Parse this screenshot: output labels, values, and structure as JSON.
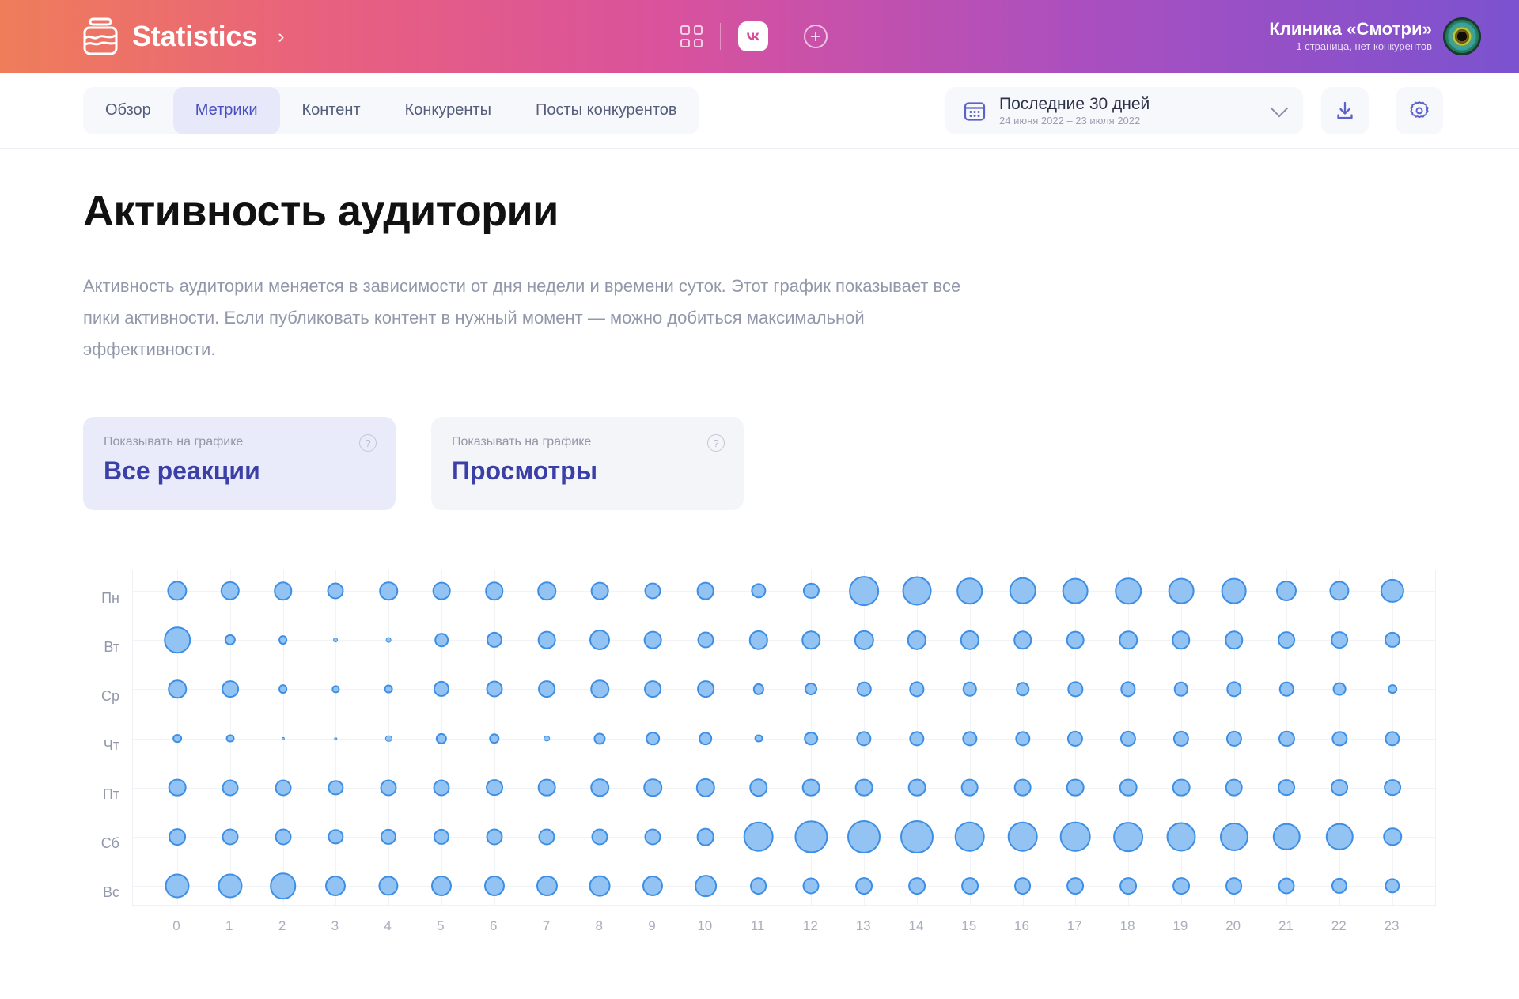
{
  "topbar": {
    "brand": "Statistics",
    "brand_chevron": "›",
    "icons": [
      "grid-icon",
      "vk-icon",
      "plus-circle-icon"
    ],
    "account_name": "Клиника «Смотри»",
    "account_sub": "1 страница, нет конкурентов"
  },
  "nav": {
    "tabs": [
      {
        "label": "Обзор",
        "active": false
      },
      {
        "label": "Метрики",
        "active": true
      },
      {
        "label": "Контент",
        "active": false
      },
      {
        "label": "Конкуренты",
        "active": false
      },
      {
        "label": "Посты конкурентов",
        "active": false
      }
    ],
    "daterange": {
      "title": "Последние 30 дней",
      "subtitle": "24 июня 2022 – 23 июля 2022"
    },
    "download_label": "download-icon",
    "settings_label": "gear-icon"
  },
  "main": {
    "title": "Активность аудитории",
    "description": "Активность аудитории меняется в зависимости от дня недели и времени суток. Этот график показывает все пики активности. Если публиковать контент в нужный момент — можно добиться максимальной эффективности.",
    "cards": [
      {
        "label": "Показывать на графике",
        "value": "Все реакции",
        "selected": true,
        "help": "?"
      },
      {
        "label": "Показывать на графике",
        "value": "Просмотры",
        "selected": false,
        "help": "?"
      }
    ]
  },
  "colors": {
    "bubble_fill": "#93c3f2",
    "bubble_stroke": "#3d8fe6",
    "accent": "#3b3fa8",
    "card_selected_bg": "#e9eafa",
    "tab_active_bg": "#e7e9fb"
  },
  "chart_data": {
    "type": "heatmap",
    "title": "Активность аудитории",
    "xlabel": "",
    "ylabel": "",
    "legend_position": "none",
    "grid": true,
    "x": [
      0,
      1,
      2,
      3,
      4,
      5,
      6,
      7,
      8,
      9,
      10,
      11,
      12,
      13,
      14,
      15,
      16,
      17,
      18,
      19,
      20,
      21,
      22,
      23
    ],
    "categories": [
      "Пн",
      "Вт",
      "Ср",
      "Чт",
      "Пт",
      "Сб",
      "Вс"
    ],
    "value_unit": "relative bubble radius (0-1)",
    "series": [
      {
        "name": "Пн",
        "values": [
          0.6,
          0.58,
          0.56,
          0.5,
          0.56,
          0.54,
          0.56,
          0.56,
          0.54,
          0.5,
          0.54,
          0.46,
          0.48,
          0.9,
          0.88,
          0.8,
          0.82,
          0.78,
          0.8,
          0.78,
          0.78,
          0.62,
          0.6,
          0.72
        ]
      },
      {
        "name": "Вт",
        "values": [
          0.8,
          0.34,
          0.28,
          0.14,
          0.16,
          0.42,
          0.48,
          0.54,
          0.62,
          0.54,
          0.5,
          0.58,
          0.56,
          0.58,
          0.58,
          0.58,
          0.56,
          0.54,
          0.56,
          0.56,
          0.56,
          0.52,
          0.52,
          0.48
        ]
      },
      {
        "name": "Ср",
        "values": [
          0.56,
          0.52,
          0.28,
          0.22,
          0.26,
          0.48,
          0.5,
          0.52,
          0.56,
          0.52,
          0.52,
          0.34,
          0.38,
          0.44,
          0.46,
          0.44,
          0.42,
          0.46,
          0.46,
          0.44,
          0.46,
          0.44,
          0.4,
          0.28
        ]
      },
      {
        "name": "Чт",
        "values": [
          0.28,
          0.26,
          0.1,
          0.08,
          0.2,
          0.34,
          0.32,
          0.18,
          0.36,
          0.42,
          0.42,
          0.26,
          0.42,
          0.46,
          0.46,
          0.46,
          0.46,
          0.48,
          0.48,
          0.48,
          0.48,
          0.48,
          0.46,
          0.46
        ]
      },
      {
        "name": "Пт",
        "values": [
          0.54,
          0.5,
          0.5,
          0.46,
          0.5,
          0.5,
          0.52,
          0.54,
          0.56,
          0.56,
          0.58,
          0.56,
          0.54,
          0.54,
          0.54,
          0.54,
          0.54,
          0.54,
          0.54,
          0.54,
          0.54,
          0.52,
          0.52,
          0.52
        ]
      },
      {
        "name": "Сб",
        "values": [
          0.52,
          0.5,
          0.5,
          0.46,
          0.48,
          0.48,
          0.5,
          0.5,
          0.5,
          0.5,
          0.54,
          0.92,
          0.98,
          1.0,
          1.0,
          0.92,
          0.92,
          0.92,
          0.9,
          0.88,
          0.86,
          0.82,
          0.82,
          0.56
        ]
      },
      {
        "name": "Вс",
        "values": [
          0.74,
          0.74,
          0.8,
          0.62,
          0.6,
          0.62,
          0.62,
          0.62,
          0.64,
          0.62,
          0.66,
          0.52,
          0.5,
          0.52,
          0.52,
          0.52,
          0.52,
          0.52,
          0.52,
          0.52,
          0.52,
          0.5,
          0.48,
          0.46
        ]
      }
    ]
  }
}
